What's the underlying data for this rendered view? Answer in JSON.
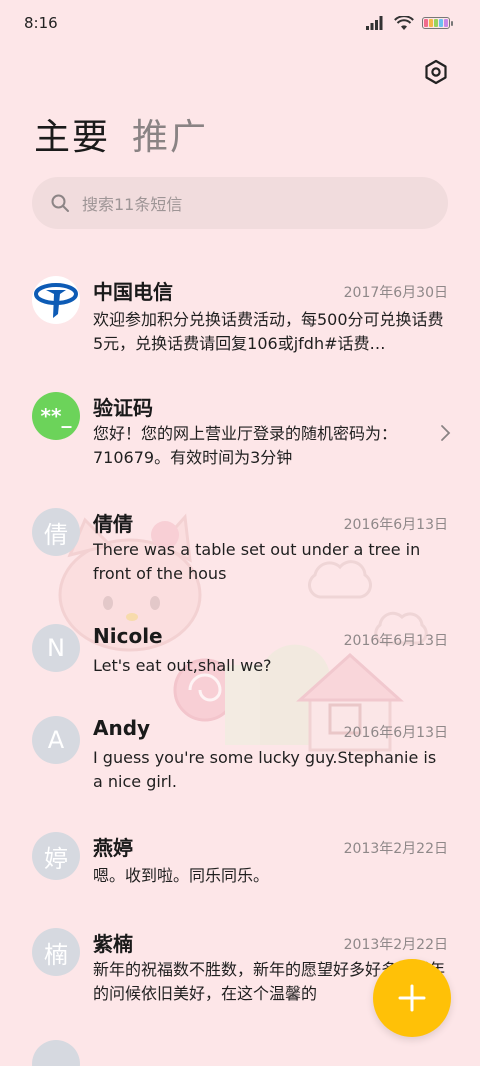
{
  "status_bar": {
    "time": "8:16"
  },
  "tabs": [
    {
      "label": "主要"
    },
    {
      "label": "推广"
    }
  ],
  "search": {
    "placeholder": "搜索11条短信"
  },
  "messages": [
    {
      "name": "中国电信",
      "date": "2017年6月30日",
      "preview": "欢迎参加积分兑换话费活动，每500分可兑换话费5元，兑换话费请回复106或jfdh#话费…",
      "avatar": "telecom-logo"
    },
    {
      "name": "验证码",
      "date": "",
      "preview": "您好！您的网上营业厅登录的随机密码为：710679。有效时间为3分钟",
      "avatar_text": "**_"
    },
    {
      "name": "倩倩",
      "date": "2016年6月13日",
      "preview": "There was a table set out under a tree in front of the hous",
      "avatar_text": "倩"
    },
    {
      "name": "Nicole",
      "date": "2016年6月13日",
      "preview": "Let's eat out,shall we?",
      "avatar_text": "N"
    },
    {
      "name": "Andy",
      "date": "2016年6月13日",
      "preview": "I guess you're some lucky guy.Stephanie is a nice girl.",
      "avatar_text": "A"
    },
    {
      "name": "燕婷",
      "date": "2013年2月22日",
      "preview": "嗯。收到啦。同乐同乐。",
      "avatar_text": "婷"
    },
    {
      "name": "紫楠",
      "date": "2013年2月22日",
      "preview": "新年的祝福数不胜数，新年的愿望好多好多，新年的问候依旧美好，在这个温馨的",
      "avatar_text": "楠"
    }
  ],
  "colors": {
    "background": "#fde6e8",
    "fab": "#ffc107",
    "verify_avatar": "#6cd35a",
    "telecom_blue": "#0d5bb5"
  }
}
